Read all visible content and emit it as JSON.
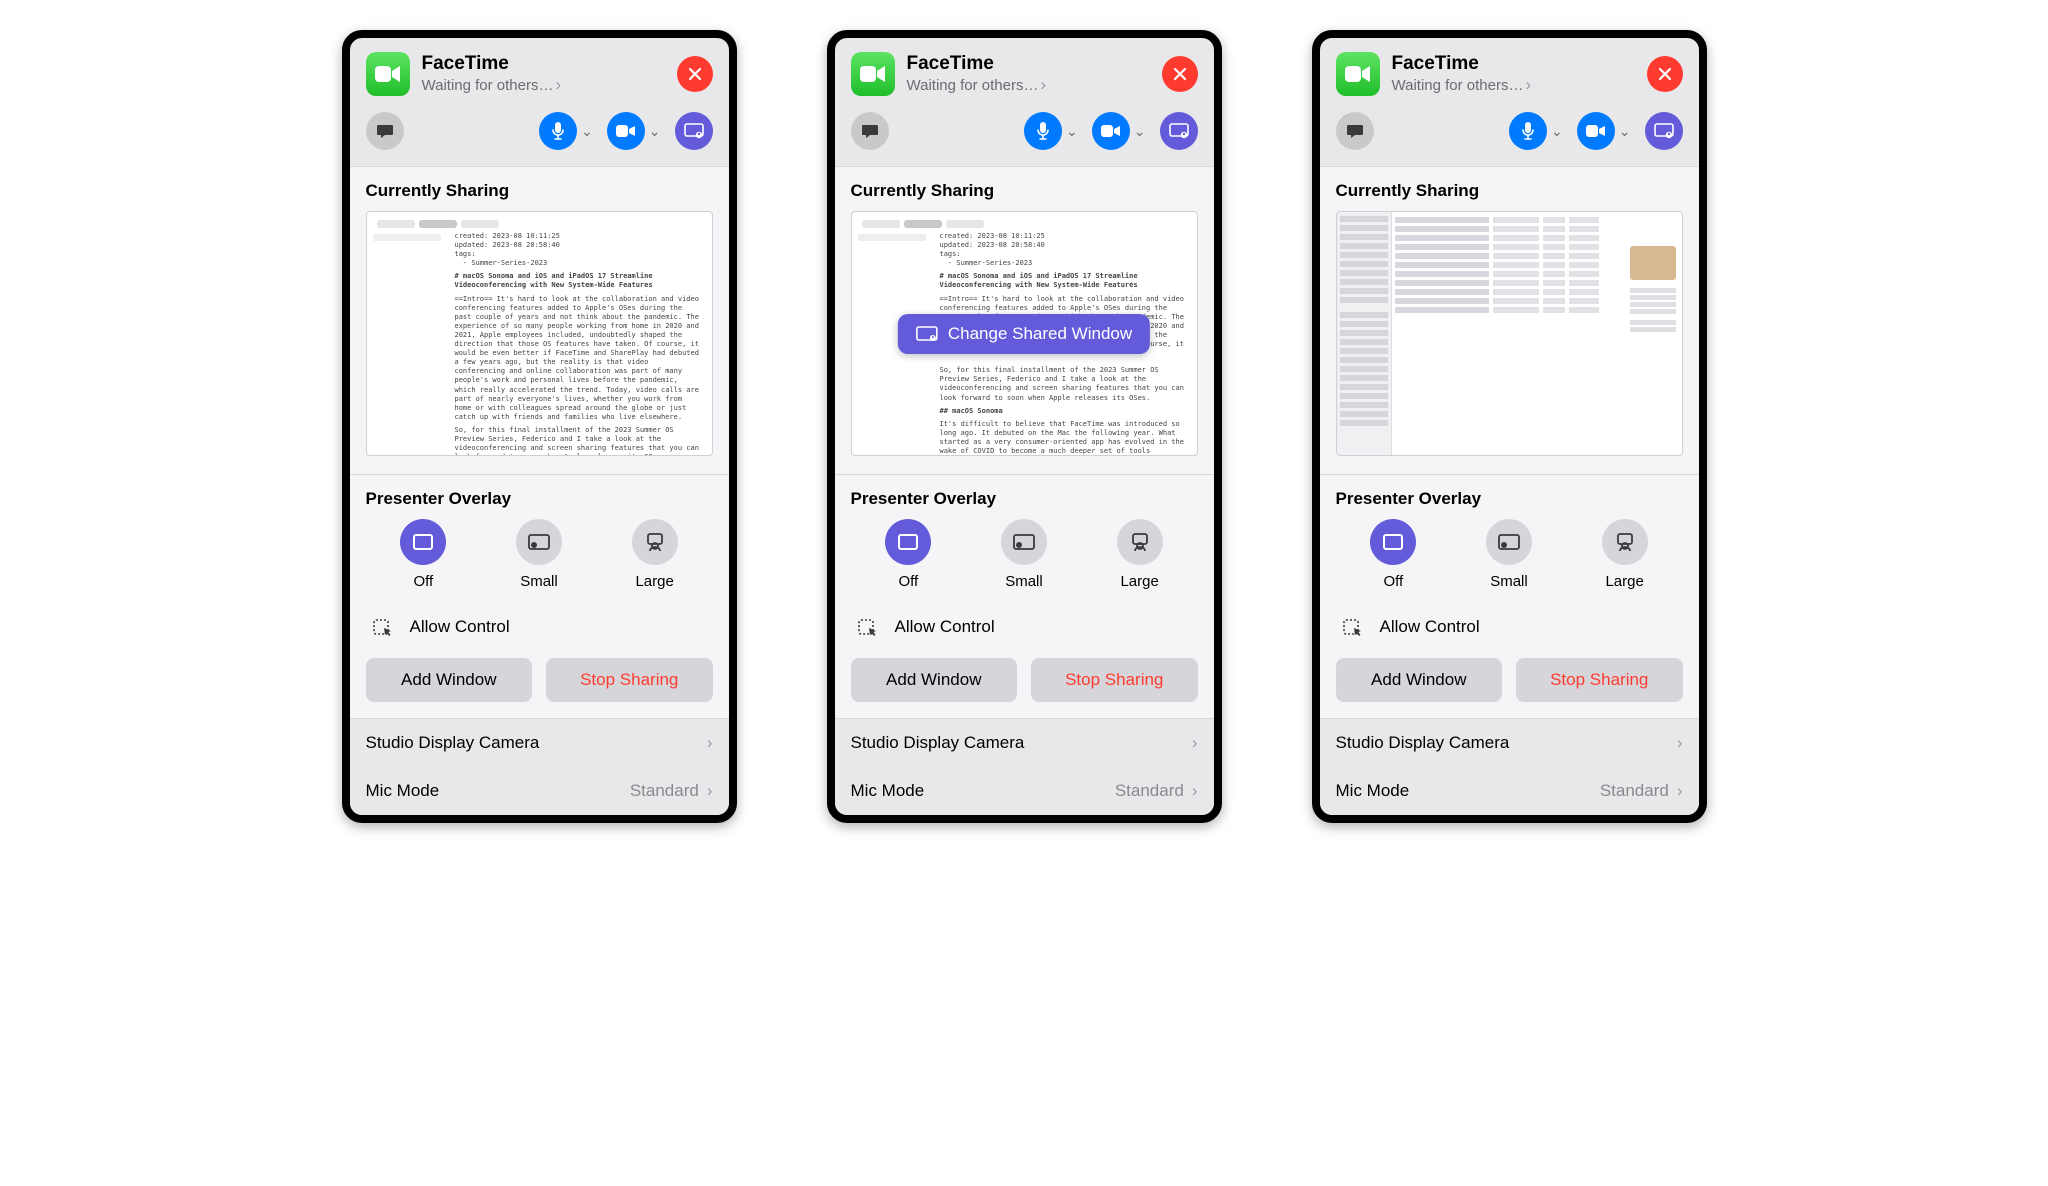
{
  "app": {
    "title": "FaceTime",
    "subtitle": "Waiting for others…"
  },
  "sharing": {
    "title": "Currently Sharing",
    "change_label": "Change Shared Window"
  },
  "presenter": {
    "title": "Presenter Overlay",
    "off": "Off",
    "small": "Small",
    "large": "Large",
    "allow_control": "Allow Control",
    "add_window": "Add Window",
    "stop_sharing": "Stop Sharing"
  },
  "bottom": {
    "camera": "Studio Display Camera",
    "mic_mode": "Mic Mode",
    "mic_mode_value": "Standard"
  }
}
